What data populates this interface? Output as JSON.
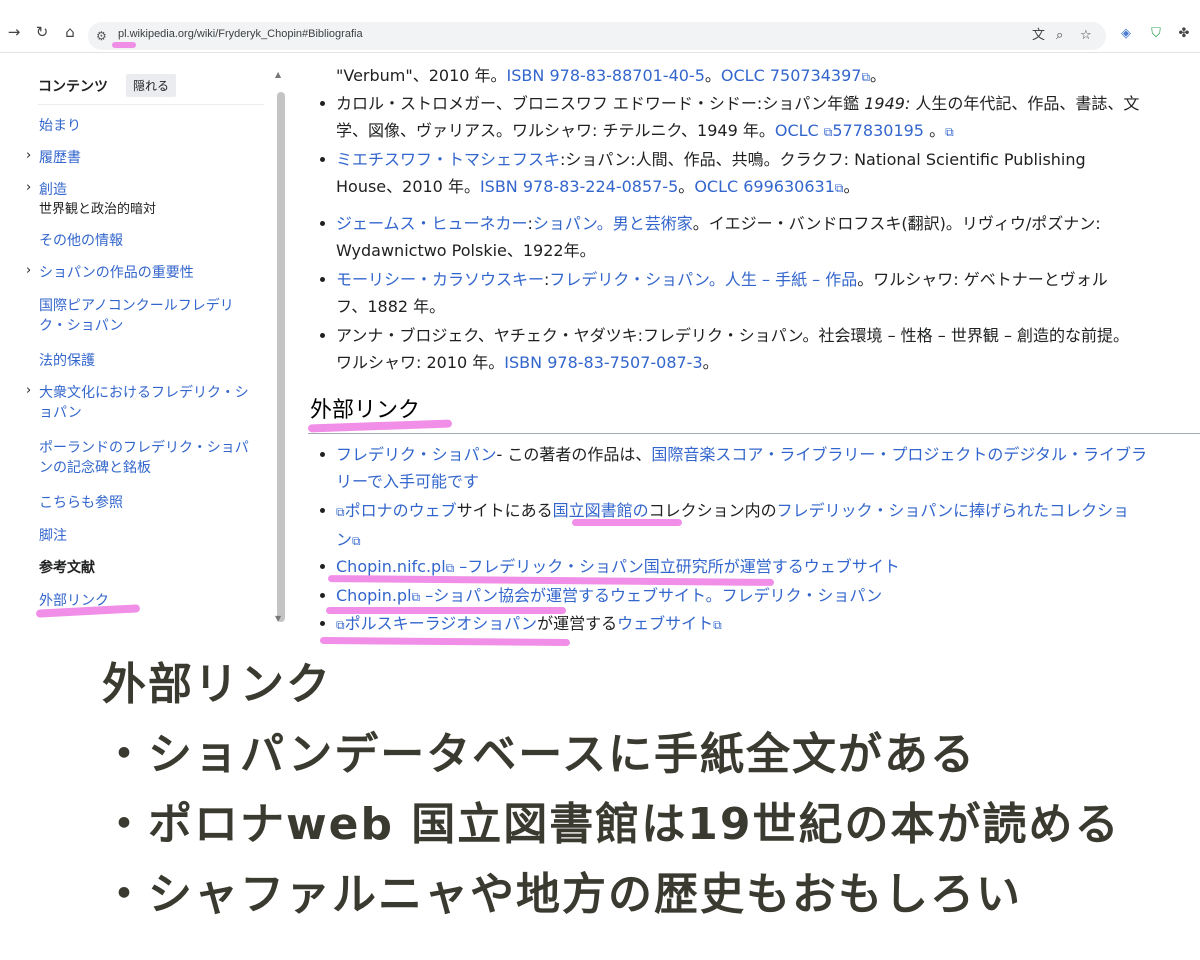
{
  "browser": {
    "url": "pl.wikipedia.org/wiki/Fryderyk_Chopin#Bibliografia",
    "icons": [
      "back-arrow",
      "reload",
      "home",
      "site-settings",
      "translate",
      "zoom",
      "bookmark-star",
      "extension-translate",
      "extension-shield",
      "extensions-puzzle"
    ]
  },
  "sidebar": {
    "title": "コンテンツ",
    "hide_label": "隠れる",
    "items": [
      {
        "label": "始まり"
      },
      {
        "label": "履歴書"
      },
      {
        "label": "創造",
        "sub": "世界観と政治的暗対"
      },
      {
        "label": "その他の情報"
      },
      {
        "label": "ショパンの作品の重要性"
      },
      {
        "label": "国際ピアノコンクールフレデリ",
        "label2": "ク・ショパン"
      },
      {
        "label": "法的保護"
      },
      {
        "label": "大衆文化におけるフレデリク・シ",
        "label2": "ョパン"
      },
      {
        "label": "ポーランドのフレデリク・ショパ",
        "label2": "ンの記念碑と銘板"
      },
      {
        "label": "こちらも参照"
      },
      {
        "label": "脚注"
      },
      {
        "label": "参考文献"
      },
      {
        "label": "外部リンク"
      }
    ]
  },
  "bibliography": {
    "item0": {
      "pre": "\"Verbum\"、2010 年。",
      "isbn": "ISBN 978-83-88701-40-5",
      "sep": "。",
      "oclc": "OCLC 750734397",
      "post": "。"
    },
    "item1": {
      "l1": "カロル・ストロメガー、ブロニスワフ エドワード・シドー:ショパン年鑑 ",
      "year_italic": "1949:",
      "l1b": " 人生の年代記、作品、書誌、文",
      "l2": "学、図像、ヴァリアス。ワルシャワ: チテルニク、1949 年。",
      "oclc": "OCLC ",
      "oclc2": "577830195",
      "post": " 。"
    },
    "item2": {
      "author": "ミエチスワフ・トマシェフスキ",
      "l1": ":ショパン:人間、作品、共鳴。クラクフ: National Scientific Publishing",
      "l2": "House、2010 年。",
      "isbn": "ISBN 978-83-224-0857-5",
      "sep": "。",
      "oclc": "OCLC 699630631",
      "post": "。"
    },
    "item3": {
      "author": "ジェームス・ヒューネカー",
      "sep": ":",
      "title": "ショパン。男と芸術家",
      "l1": "。イエジー・バンドロフスキ(翻訳)。リヴィウ/ポズナン:",
      "l2": "Wydawnictwo Polskie、1922年。"
    },
    "item4": {
      "author": "モーリシー・カラソウスキー",
      "sep": ":",
      "title": "フレデリク・ショパン。人生 – 手紙 – 作品",
      "l1": "。ワルシャワ: ゲベトナーとヴォル",
      "l2": "フ、1882 年。"
    },
    "item5": {
      "l1": "アンナ・ブロジェク、ヤチェク・ヤダツキ:フレデリク・ショパン。社会環境 – 性格 – 世界観 – 創造的な前提。",
      "l2": "ワルシャワ: 2010 年。",
      "isbn": "ISBN 978-83-7507-087-3",
      "post": "。"
    }
  },
  "external": {
    "heading": "外部リンク",
    "item0": {
      "link": "フレデリク・ショパン",
      "mid": "- この著者の作品は、",
      "link2": "国際音楽スコア・ライブラリー・プロジェクトのデジタル・ライブラ",
      "link3": "リーで入手可能です"
    },
    "item1": {
      "link": "ポロナのウェブ",
      "mid": "サイトにある",
      "link2": "国立図書館の",
      "mid2": "コレクション内の",
      "link3": "フレデリック・ショパンに捧げられたコレクショ",
      "link4": "ン"
    },
    "item2": {
      "link": "Chopin.nifc.pl",
      "link2": " –フレデリック・ショパン国立研究所が運営するウェブサイト"
    },
    "item3": {
      "link": "Chopin.pl",
      "link2": " –ショパン協会が運営するウェブサイト。フレデリク・ショパン"
    },
    "item4": {
      "link": "ポルスキーラジオショパン",
      "mid": "が運営する",
      "link2": "ウェブサイト"
    }
  },
  "note": {
    "line1": "外部リンク",
    "line2": "・ショパンデータベースに手紙全文がある",
    "line3": "・ポロナweb 国立図書館は19世紀の本が読める",
    "line4": "・シャファルニャや地方の歴史もおもしろい"
  },
  "colors": {
    "link": "#3366cc",
    "highlight": "#ee82e6",
    "note_ink": "#3a3a30"
  }
}
